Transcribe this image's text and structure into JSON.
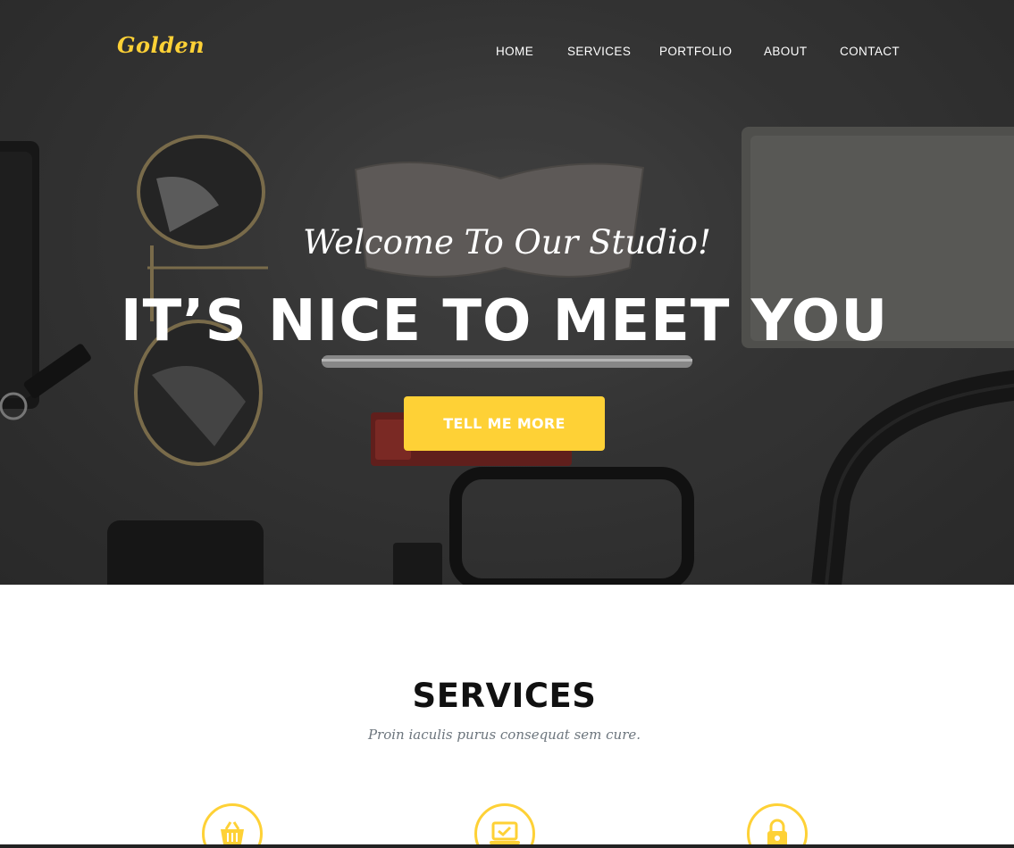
{
  "brand": {
    "logo_text": "Golden",
    "accent_color": "#fed136"
  },
  "nav": {
    "items": [
      {
        "label": "HOME"
      },
      {
        "label": "SERVICES"
      },
      {
        "label": "PORTFOLIO"
      },
      {
        "label": "ABOUT"
      },
      {
        "label": "CONTACT"
      }
    ]
  },
  "hero": {
    "lead": "Welcome To Our Studio!",
    "heading": "IT’S NICE TO MEET YOU",
    "cta_label": "TELL ME MORE"
  },
  "services": {
    "title": "SERVICES",
    "subtitle": "Proin iaculis purus consequat sem cure.",
    "icons": [
      {
        "icon": "shopping-basket-icon"
      },
      {
        "icon": "laptop-check-icon"
      },
      {
        "icon": "lock-icon"
      }
    ]
  }
}
